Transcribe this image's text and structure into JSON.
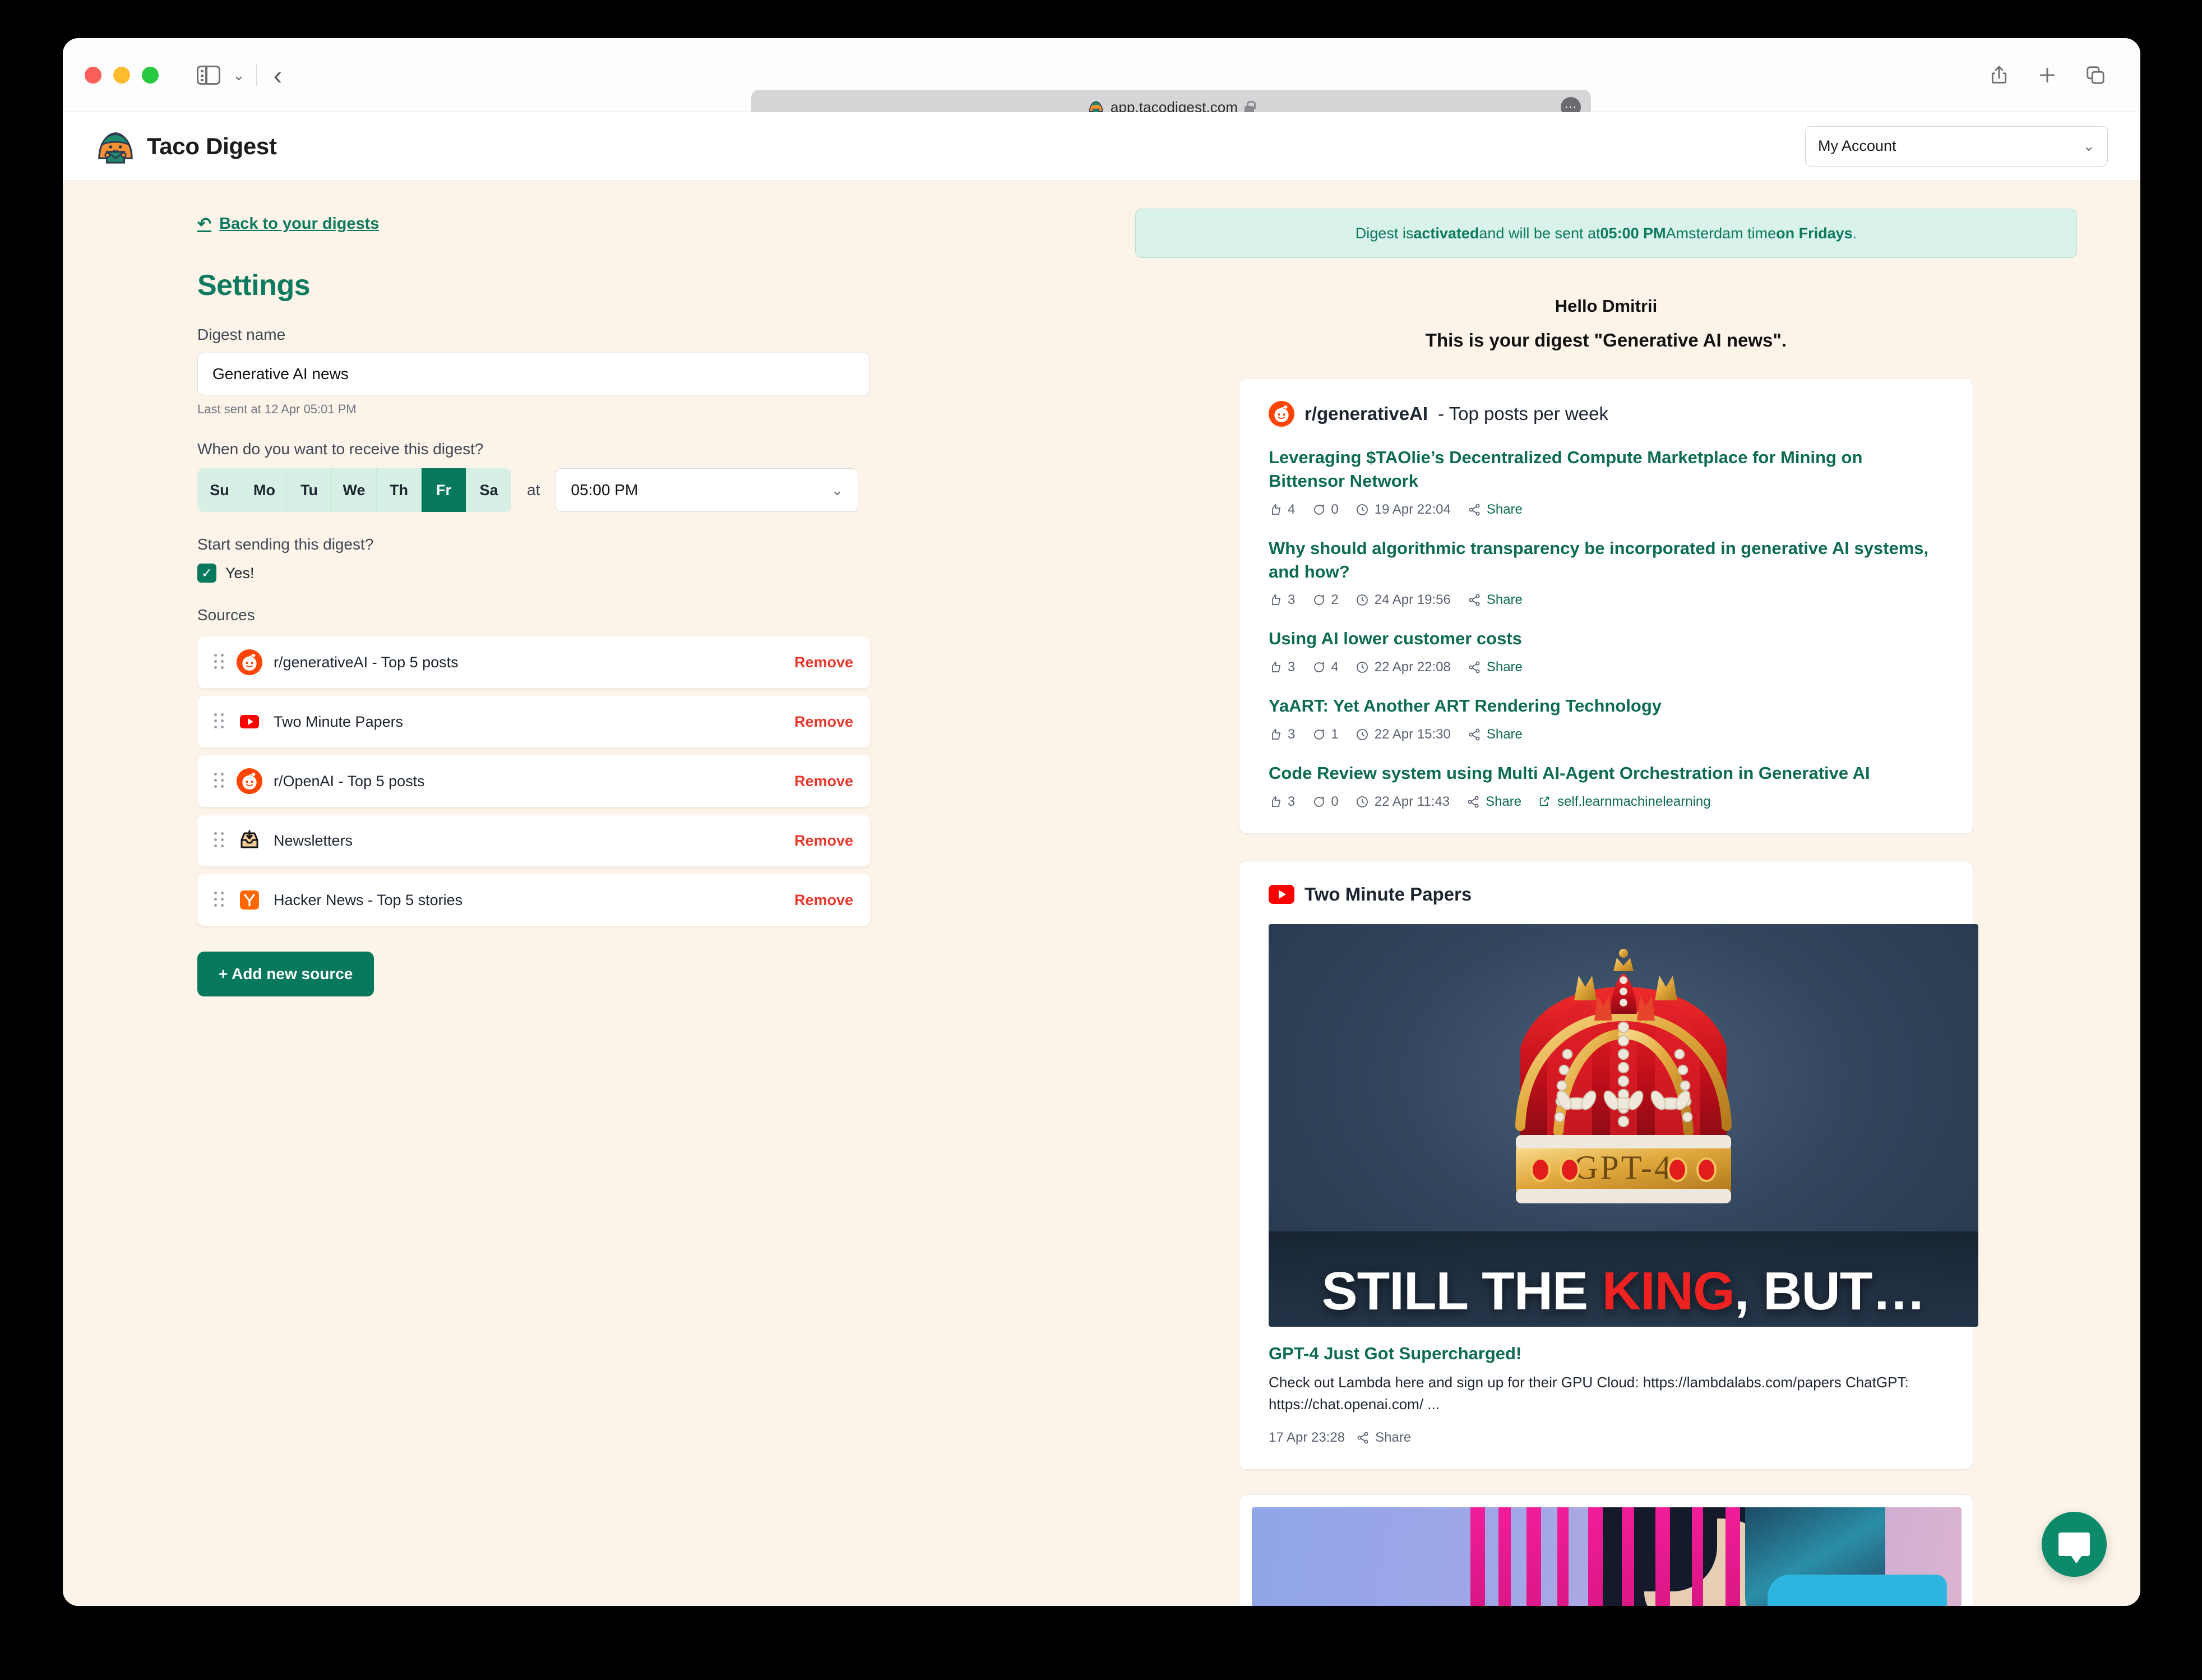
{
  "browser": {
    "url": "app.tacodigest.com",
    "url_icon": "taco-favicon",
    "lock_icon": "lock-icon",
    "more_icon": "more-options-icon",
    "share_icon": "share-icon",
    "new_tab_icon": "plus-icon",
    "tabs_icon": "tab-overview-icon",
    "sidebar_icon": "sidebar-toggle-icon",
    "back_icon": "back-chevron-icon"
  },
  "app": {
    "brand": "Taco Digest",
    "account_label": "My Account"
  },
  "settings": {
    "back_link": "Back to your digests",
    "title": "Settings",
    "digest_name_label": "Digest name",
    "digest_name_value": "Generative AI news",
    "digest_name_placeholder": "Digest name",
    "last_sent": "Last sent at 12 Apr 05:01 PM",
    "when_label": "When do you want to receive this digest?",
    "days": [
      {
        "label": "Su",
        "active": false
      },
      {
        "label": "Mo",
        "active": false
      },
      {
        "label": "Tu",
        "active": false
      },
      {
        "label": "We",
        "active": false
      },
      {
        "label": "Th",
        "active": false
      },
      {
        "label": "Fr",
        "active": true
      },
      {
        "label": "Sa",
        "active": false
      }
    ],
    "at_label": "at",
    "time_value": "05:00 PM",
    "start_label": "Start sending this digest?",
    "checkbox_label": "Yes!",
    "checkbox_checked": true,
    "sources_label": "Sources",
    "sources": [
      {
        "name": "r/generativeAI - Top 5 posts",
        "icon": "reddit-icon",
        "remove": "Remove"
      },
      {
        "name": "Two Minute Papers",
        "icon": "youtube-icon",
        "remove": "Remove"
      },
      {
        "name": "r/OpenAI - Top 5 posts",
        "icon": "reddit-icon",
        "remove": "Remove"
      },
      {
        "name": "Newsletters",
        "icon": "inbox-icon",
        "remove": "Remove"
      },
      {
        "name": "Hacker News - Top 5 stories",
        "icon": "hackernews-icon",
        "remove": "Remove"
      }
    ],
    "add_source_label": "+ Add new source"
  },
  "preview": {
    "banner": {
      "p1": "Digest is ",
      "activated": "activated",
      "p2": " and will be sent at ",
      "time": "05:00 PM",
      "p3": " Amsterdam time ",
      "day": "on Fridays",
      "p4": "."
    },
    "greeting": "Hello Dmitrii",
    "subgreeting": "This is your digest \"Generative AI news\".",
    "reddit_card": {
      "icon": "reddit-icon",
      "title_bold": "r/generativeAI",
      "title_rest": " - Top posts per week",
      "posts": [
        {
          "title": "Leveraging $TAOlie’s Decentralized Compute Marketplace for Mining on Bittensor Network",
          "upvotes": "4",
          "comments": "0",
          "time": "19 Apr 22:04",
          "share": "Share",
          "source": ""
        },
        {
          "title": "Why should algorithmic transparency be incorporated in generative AI systems, and how?",
          "upvotes": "3",
          "comments": "2",
          "time": "24 Apr 19:56",
          "share": "Share",
          "source": ""
        },
        {
          "title": "Using AI lower customer costs",
          "upvotes": "3",
          "comments": "4",
          "time": "22 Apr 22:08",
          "share": "Share",
          "source": ""
        },
        {
          "title": "YaART: Yet Another ART Rendering Technology",
          "upvotes": "3",
          "comments": "1",
          "time": "22 Apr 15:30",
          "share": "Share",
          "source": ""
        },
        {
          "title": "Code Review system using Multi AI-Agent Orchestration in Generative AI",
          "upvotes": "3",
          "comments": "0",
          "time": "22 Apr 11:43",
          "share": "Share",
          "source": "self.learnmachinelearning"
        }
      ]
    },
    "youtube_card": {
      "icon": "youtube-icon",
      "title": "Two Minute Papers",
      "thumbnail": {
        "caption_pre": "STILL THE ",
        "caption_king": "KING",
        "caption_post": ", BUT…",
        "crown_label": "GPT-4"
      },
      "video_title": "GPT-4 Just Got Supercharged!",
      "video_desc": "Check out Lambda here and sign up for their GPU Cloud: https://lambdalabs.com/papers ChatGPT: https://chat.openai.com/ ...",
      "video_time": "17 Apr 23:28",
      "video_share": "Share"
    }
  },
  "chat": {
    "icon": "chat-bubble-icon"
  },
  "colors": {
    "brand_green": "#06785c",
    "link_green": "#0d6b52",
    "page_bg": "#fdf4e9",
    "remove_red": "#e63a2e",
    "reddit_orange": "#ff4500",
    "youtube_red": "#ff0000",
    "hn_orange": "#ff6600"
  }
}
